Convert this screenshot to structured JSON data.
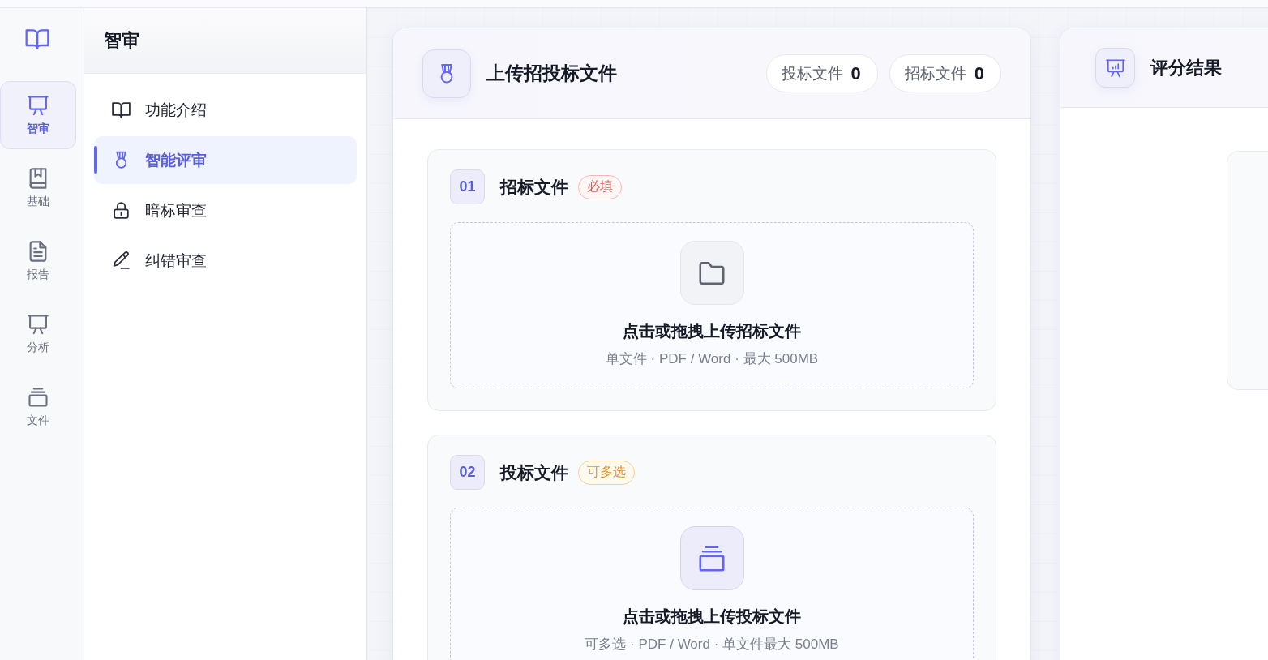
{
  "rail": {
    "items": [
      {
        "label": "智审",
        "selected": true
      },
      {
        "label": "基础",
        "selected": false
      },
      {
        "label": "报告",
        "selected": false
      },
      {
        "label": "分析",
        "selected": false
      },
      {
        "label": "文件",
        "selected": false
      }
    ]
  },
  "sidebar": {
    "title": "智审",
    "items": [
      {
        "label": "功能介绍",
        "selected": false
      },
      {
        "label": "智能评审",
        "selected": true
      },
      {
        "label": "暗标审查",
        "selected": false
      },
      {
        "label": "纠错审查",
        "selected": false
      }
    ]
  },
  "upload_panel": {
    "title": "上传招投标文件",
    "counters": [
      {
        "label": "投标文件",
        "count": "0"
      },
      {
        "label": "招标文件",
        "count": "0"
      }
    ],
    "sections": [
      {
        "kind": "single",
        "number": "01",
        "title": "招标文件",
        "tag": "必填",
        "dropzone": {
          "title": "点击或拖拽上传招标文件",
          "hint": "单文件 · PDF / Word · 最大 500MB"
        }
      },
      {
        "kind": "multiple",
        "number": "02",
        "title": "投标文件",
        "tag": "可多选",
        "dropzone": {
          "title": "点击或拖拽上传投标文件",
          "hint": "可多选 · PDF / Word · 单文件最大 500MB"
        }
      }
    ]
  },
  "result_panel": {
    "title": "评分结果"
  }
}
